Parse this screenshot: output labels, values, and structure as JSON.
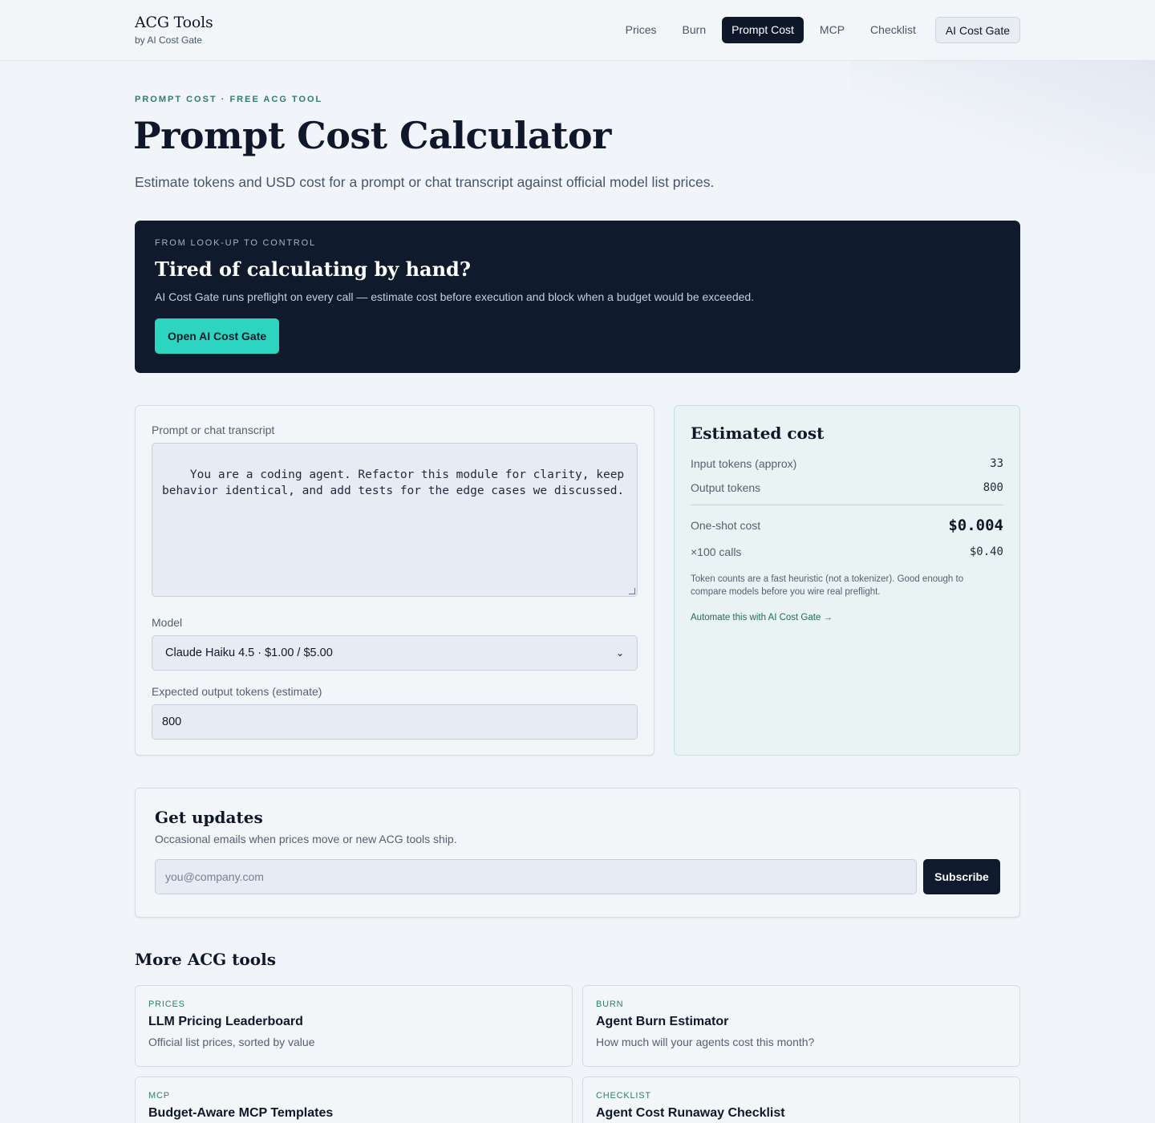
{
  "header": {
    "brand_title": "ACG Tools",
    "brand_subtitle": "by AI Cost Gate",
    "nav": [
      {
        "label": "Prices"
      },
      {
        "label": "Burn"
      },
      {
        "label": "Prompt Cost",
        "active": true
      },
      {
        "label": "MCP"
      },
      {
        "label": "Checklist"
      }
    ],
    "cta_label": "AI Cost Gate"
  },
  "hero": {
    "eyebrow": "PROMPT COST · FREE ACG TOOL",
    "title": "Prompt Cost Calculator",
    "lead": "Estimate tokens and USD cost for a prompt or chat transcript against official model list prices."
  },
  "promo": {
    "eyebrow": "FROM LOOK-UP TO CONTROL",
    "title": "Tired of calculating by hand?",
    "text": "AI Cost Gate runs preflight on every call — estimate cost before execution and block when a budget would be exceeded.",
    "button_label": "Open AI Cost Gate",
    "colors": {
      "background": "#0f1a2c",
      "button": "#2dd4bf"
    }
  },
  "calculator": {
    "prompt_label": "Prompt or chat transcript",
    "prompt_value": "You are a coding agent. Refactor this module for clarity, keep\nbehavior identical, and add tests for the edge cases we discussed.",
    "model_label": "Model",
    "model_value": "Claude Haiku 4.5 · $1.00 / $5.00",
    "output_label": "Expected output tokens (estimate)",
    "output_value": "800"
  },
  "estimate": {
    "title": "Estimated cost",
    "rows": [
      {
        "label": "Input tokens (approx)",
        "value": "33"
      },
      {
        "label": "Output tokens",
        "value": "800"
      },
      {
        "label": "One-shot cost",
        "value": "$0.004"
      },
      {
        "label": "×100 calls",
        "value": "$0.40"
      }
    ],
    "note": "Token counts are a fast heuristic (not a tokenizer). Good enough to compare models before you wire real preflight.",
    "link_label": "Automate this with AI Cost Gate →"
  },
  "updates": {
    "title": "Get updates",
    "text": "Occasional emails when prices move or new ACG tools ship.",
    "email_placeholder": "you@company.com",
    "button_label": "Subscribe"
  },
  "more_tools": {
    "title": "More ACG tools",
    "items": [
      {
        "tag": "PRICES",
        "name": "LLM Pricing Leaderboard",
        "desc": "Official list prices, sorted by value"
      },
      {
        "tag": "BURN",
        "name": "Agent Burn Estimator",
        "desc": "How much will your agents cost this month?"
      },
      {
        "tag": "MCP",
        "name": "Budget-Aware MCP Templates",
        "desc": ""
      },
      {
        "tag": "CHECKLIST",
        "name": "Agent Cost Runaway Checklist",
        "desc": ""
      }
    ]
  },
  "colors": {
    "accent": "#2dd4bf",
    "navy": "#0f172a",
    "eyebrow": "#2f7d6d"
  }
}
